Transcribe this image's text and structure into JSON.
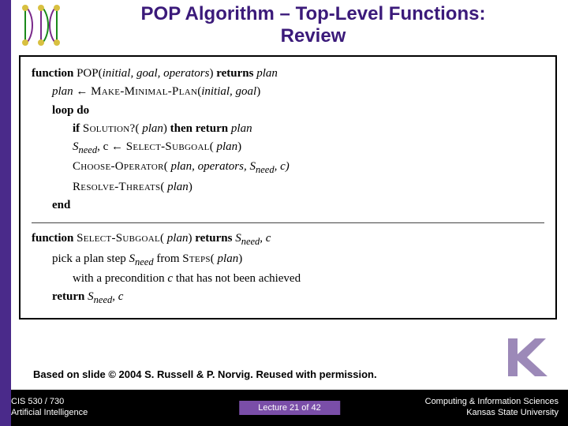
{
  "title_line1": "POP Algorithm – Top-Level Functions:",
  "title_line2": "Review",
  "algo": {
    "l1a": "function ",
    "l1b": "POP",
    "l1c": "(",
    "l1d": "initial, goal, operators",
    "l1e": ") ",
    "l1f": "returns ",
    "l1g": "plan",
    "l2a": "plan",
    "l2b": " ← ",
    "l2c": "Make-Minimal-Plan",
    "l2d": "(",
    "l2e": "initial, goal",
    "l2f": ")",
    "l3": "loop do",
    "l4a": "if ",
    "l4b": "Solution?",
    "l4c": "( ",
    "l4d": "plan",
    "l4e": ") ",
    "l4f": "then return ",
    "l4g": "plan",
    "l5a": "S",
    "l5b": "need",
    "l5c": ",  c ← ",
    "l5d": "Select-Subgoal",
    "l5e": "( ",
    "l5f": "plan",
    "l5g": ")",
    "l6a": "Choose-Operator",
    "l6b": "( ",
    "l6c": "plan, operators, S",
    "l6d": "need",
    "l6e": ", c)",
    "l7a": "Resolve-Threats",
    "l7b": "( ",
    "l7c": "plan",
    "l7d": ")",
    "l8": "end",
    "s1a": "function ",
    "s1b": "Select-Subgoal",
    "s1c": "( ",
    "s1d": "plan",
    "s1e": ") ",
    "s1f": "returns ",
    "s1g": "S",
    "s1h": "need",
    "s1i": ",  c",
    "s2a": "pick a plan step ",
    "s2b": "S",
    "s2c": "need",
    "s2d": " from ",
    "s2e": "Steps",
    "s2f": "( ",
    "s2g": "plan",
    "s2h": ")",
    "s3a": "with a precondition ",
    "s3b": "c",
    "s3c": " that has not been achieved",
    "s4a": "return ",
    "s4b": "S",
    "s4c": "need",
    "s4d": ",  c"
  },
  "credit": "Based on slide © 2004 S. Russell & P. Norvig.  Reused with permission.",
  "footer": {
    "left1": "CIS 530 / 730",
    "left2": "Artificial Intelligence",
    "center": "Lecture 21 of 42",
    "right1": "Computing & Information Sciences",
    "right2": "Kansas State University"
  }
}
